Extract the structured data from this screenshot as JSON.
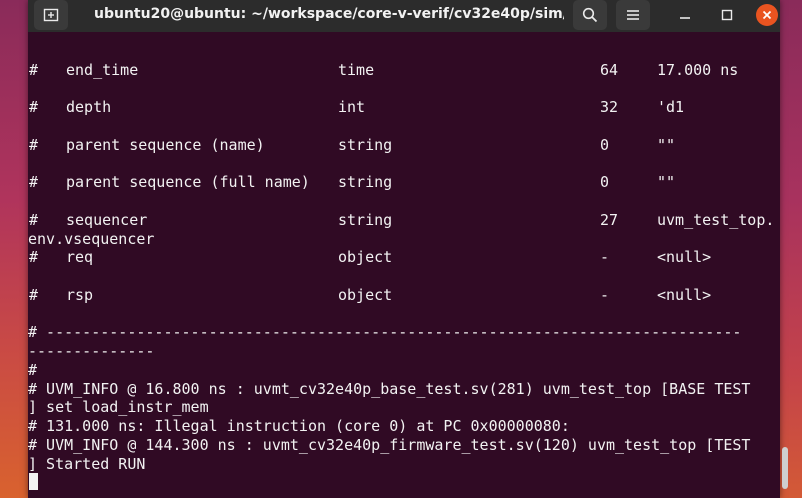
{
  "window": {
    "title": "ubuntu20@ubuntu: ~/workspace/core-v-verif/cv32e40p/sim/...",
    "new_tab_icon": "new-tab-icon",
    "search_icon": "search-icon",
    "menu_icon": "hamburger-menu-icon",
    "minimize_icon": "minimize-icon",
    "maximize_icon": "maximize-icon",
    "close_icon": "close-icon",
    "close_color": "#e95420"
  },
  "terminal": {
    "background": "#300a24",
    "fields": [
      {
        "hash": "#",
        "name": "end_time",
        "type": "time",
        "size": "64",
        "value": "17.000 ns"
      },
      {
        "hash": "#",
        "name": "depth",
        "type": "int",
        "size": "32",
        "value": "'d1"
      },
      {
        "hash": "#",
        "name": "parent sequence (name)",
        "type": "string",
        "size": "0",
        "value": "\"\""
      },
      {
        "hash": "#",
        "name": "parent sequence (full name)",
        "type": "string",
        "size": "0",
        "value": "\"\""
      },
      {
        "hash": "#",
        "name": "sequencer",
        "type": "string",
        "size": "27",
        "value": "uvm_test_top.",
        "wrap": "env.vsequencer"
      },
      {
        "hash": "#",
        "name": "req",
        "type": "object",
        "size": "-",
        "value": "<null>"
      },
      {
        "hash": "#",
        "name": "rsp",
        "type": "object",
        "size": "-",
        "value": "<null>"
      }
    ],
    "log_lines": [
      "# -----------------------------------------------------------------------------",
      "--------------",
      "#",
      "# UVM_INFO @ 16.800 ns : uvmt_cv32e40p_base_test.sv(281) uvm_test_top [BASE TEST",
      "] set load_instr_mem",
      "# 131.000 ns: Illegal instruction (core 0) at PC 0x00000080:",
      "# UVM_INFO @ 144.300 ns : uvmt_cv32e40p_firmware_test.sv(120) uvm_test_top [TEST",
      "] Started RUN"
    ]
  }
}
